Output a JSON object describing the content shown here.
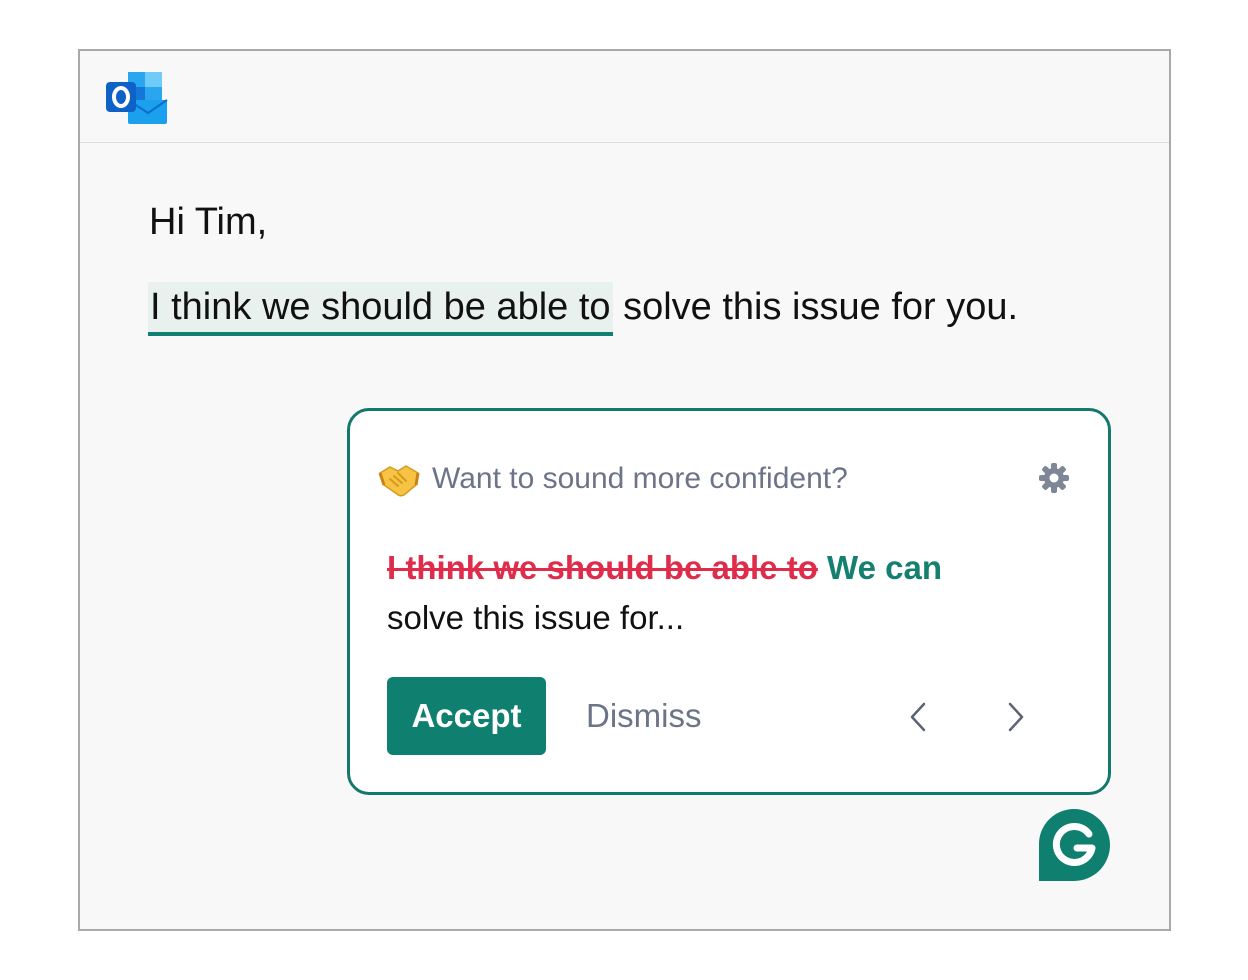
{
  "email": {
    "greeting": "Hi Tim,",
    "flagged_phrase": "I think we should be able to",
    "rest_of_sentence": " solve this issue for you."
  },
  "suggestion_card": {
    "title": "Want to sound more confident?",
    "removed_text": "I think we should be able to",
    "replacement_text": "We can",
    "remaining_text": "solve this issue for...",
    "accept_label": "Accept",
    "dismiss_label": "Dismiss"
  },
  "icons": {
    "app_logo": "outlook-logo",
    "tone_icon": "handshake-icon",
    "settings_icon": "gear-icon",
    "prev_icon": "chevron-left-icon",
    "next_icon": "chevron-right-icon",
    "assistant_logo": "grammarly-logo"
  },
  "colors": {
    "accent": "#0f7f6f",
    "strike": "#e02c4b",
    "muted_text": "#6c7488",
    "highlight_bg": "#e9f1ee"
  }
}
